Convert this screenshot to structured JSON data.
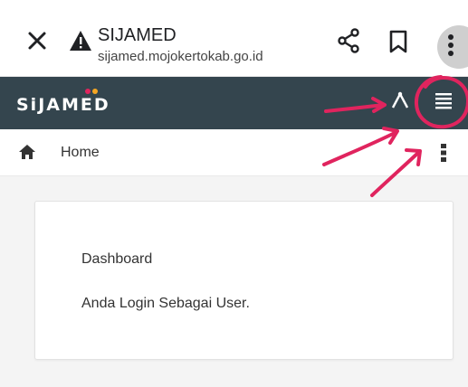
{
  "browser": {
    "site_title": "SIJAMED",
    "site_url": "sijamed.mojokertokab.go.id",
    "icons": [
      "close-icon",
      "warning-icon",
      "share-icon",
      "bookmark-icon",
      "more-vert-icon"
    ]
  },
  "navbar": {
    "brand": "SiJAMED",
    "brand_parts": [
      "SiJA",
      "M",
      "ED"
    ],
    "background": "#34454e",
    "icons": [
      "graph-icon",
      "hamburger-icon"
    ]
  },
  "breadcrumb": {
    "label": "Home",
    "icons": [
      "home-icon",
      "kebab-icon"
    ]
  },
  "card": {
    "title": "Dashboard",
    "text": "Anda Login Sebagai User."
  },
  "annotation": {
    "color": "#e0245e"
  }
}
